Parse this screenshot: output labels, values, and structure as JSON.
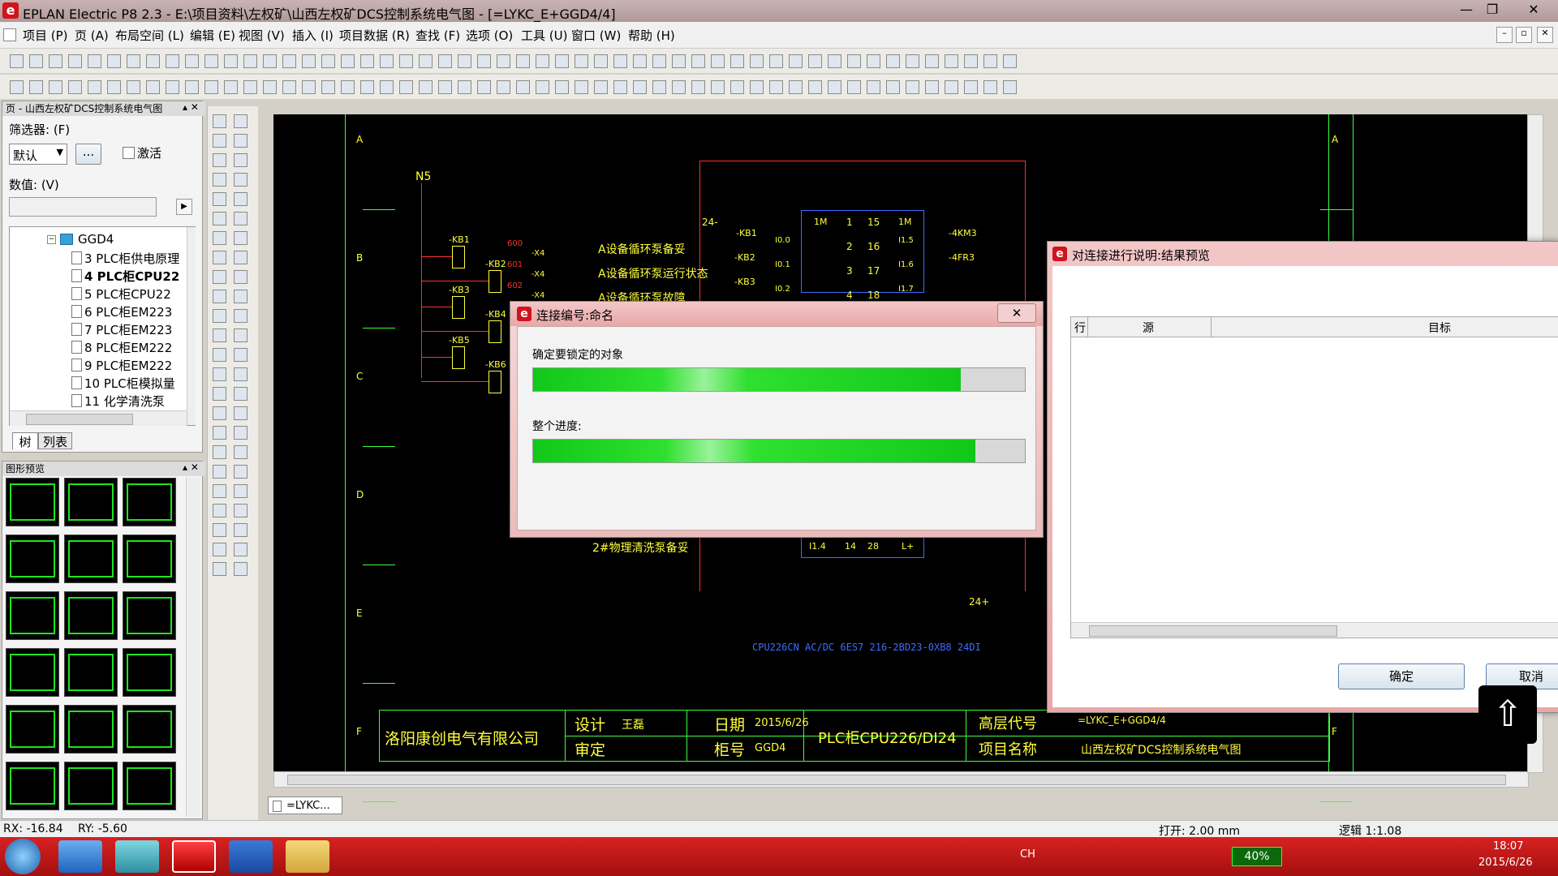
{
  "window": {
    "title": "EPLAN Electric P8 2.3 - E:\\项目资料\\左权矿\\山西左权矿DCS控制系统电气图 - [=LYKC_E+GGD4/4]",
    "logo_letter": "e",
    "min_symbol": "—",
    "restore_symbol": "❐",
    "close_symbol": "✕"
  },
  "menu": [
    "项目 (P)",
    "页 (A)",
    "布局空间 (L)",
    "编辑 (E)",
    "视图 (V)",
    "插入 (I)",
    "项目数据 (R)",
    "查找 (F)",
    "选项 (O)",
    "工具 (U)",
    "窗口 (W)",
    "帮助 (H)"
  ],
  "page_nav": {
    "title": "页 - 山西左权矿DCS控制系统电气图",
    "filter_label": "筛选器: (F)",
    "filter_value": "默认",
    "more_button": "...",
    "activate_label": "激活",
    "value_label": "数值: (V)",
    "tree_root": "GGD4",
    "tree_items": [
      "3 PLC柜供电原理",
      "4 PLC柜CPU22",
      "5 PLC柜CPU22",
      "6 PLC柜EM223",
      "7 PLC柜EM223",
      "8 PLC柜EM222",
      "9 PLC柜EM222",
      "10 PLC柜模拟量",
      "11 化学清洗泵"
    ],
    "selected_index": 1,
    "tab_tree": "树",
    "tab_list": "列表"
  },
  "preview": {
    "title": "图形预览"
  },
  "drawing": {
    "row_letters": [
      "A",
      "B",
      "C",
      "D",
      "E",
      "F"
    ],
    "node": "N5",
    "relays": [
      "-KB1",
      "-KB2",
      "-KB3",
      "-KB4",
      "-KB5",
      "-KB6"
    ],
    "wire_labels": [
      "600",
      "601",
      "602"
    ],
    "terminal": "-X4",
    "texts": [
      "A设备循环泵备妥",
      "A设备循环泵运行状态",
      "A设备循环泵故障",
      "2#物理清洗泵备妥"
    ],
    "plc_ports_left": [
      "I0.0",
      "I0.1",
      "I0.2"
    ],
    "plc_ports_right": [
      "I1.5",
      "I1.6",
      "I1.7"
    ],
    "plc_numbers_left": [
      "1",
      "2",
      "3",
      "4"
    ],
    "plc_numbers_right": [
      "15",
      "16",
      "17",
      "18"
    ],
    "plc_row_bottom": [
      "I1.4",
      "14",
      "28",
      "L+"
    ],
    "plc_labels": [
      "-KB1",
      "-KB2",
      "-KB3",
      "-4KM3",
      "-4FR3",
      "1M",
      "1M"
    ],
    "supply": "24-",
    "supply_bottom": "24+",
    "cpu_note": "CPU226CN AC/DC 6ES7 216-2BD23-0XB8  24DI",
    "titleblock": {
      "company": "洛阳康创电气有限公司",
      "design_label": "设计",
      "designer": "王磊",
      "review_label": "审定",
      "date_label": "日期",
      "date": "2015/6/26",
      "cabinet_label": "柜号",
      "cabinet": "GGD4",
      "page_title": "PLC柜CPU226/DI24",
      "higher_code_label": "高层代号",
      "higher_code": "=LYKC_E+GGD4/4",
      "project_label": "项目名称",
      "project": "山西左权矿DCS控制系统电气图"
    },
    "tab": "=LYKC..."
  },
  "progress_dialog": {
    "title": "连接编号:命名",
    "label1": "确定要锁定的对象",
    "progress1": 0.87,
    "label2": "整个进度:",
    "progress2": 0.9,
    "close": "✕"
  },
  "preview_dialog": {
    "title": "对连接进行说明:结果预览",
    "col_row": "行",
    "col_source": "源",
    "col_target": "目标",
    "ok": "确定",
    "cancel": "取消"
  },
  "statusbar": {
    "rx": "RX: -16.84",
    "ry": "RY: -5.60",
    "open": "打开: 2.00 mm",
    "scale": "逻辑 1:1.08"
  },
  "taskbar": {
    "ime": "CH",
    "battery": "40%",
    "time": "18:07",
    "date": "2015/6/26"
  },
  "colors": {
    "title_bg": "#b09999",
    "taskbar": "#c41818",
    "progress": "#10c818",
    "drawing_bg": "#000000"
  }
}
